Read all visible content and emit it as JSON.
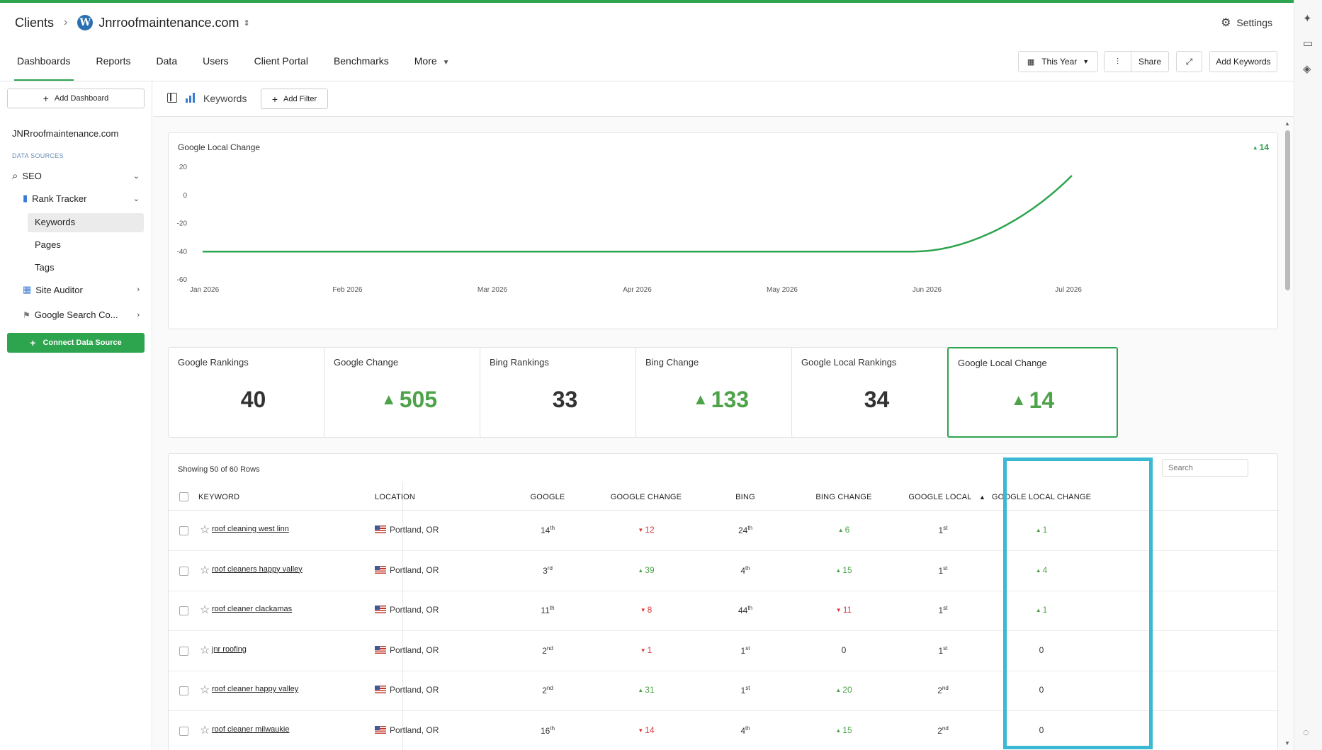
{
  "header": {
    "clients": "Clients",
    "site_name": "Jnrroofmaintenance.com",
    "settings": "Settings"
  },
  "nav": {
    "tabs": [
      "Dashboards",
      "Reports",
      "Data",
      "Users",
      "Client Portal",
      "Benchmarks",
      "More"
    ]
  },
  "toolbar": {
    "date_range": "This Year",
    "share": "Share",
    "add_keywords": "Add Keywords"
  },
  "sidebar": {
    "add_dashboard": "Add Dashboard",
    "site": "JNRroofmaintenance.com",
    "section": "DATA SOURCES",
    "seo": "SEO",
    "rank_tracker": "Rank Tracker",
    "keywords": "Keywords",
    "pages": "Pages",
    "tags": "Tags",
    "site_auditor": "Site Auditor",
    "google_search": "Google Search Co...",
    "connect": "Connect Data Source"
  },
  "filterbar": {
    "title": "Keywords",
    "add_filter": "Add Filter"
  },
  "chart_data": {
    "type": "line",
    "title": "Google Local Change",
    "badge": "14",
    "x": [
      "Jan 2026",
      "Feb 2026",
      "Mar 2026",
      "Apr 2026",
      "May 2026",
      "Jun 2026",
      "Jul 2026"
    ],
    "series": [
      {
        "values": [
          -40,
          -40,
          -40,
          -40,
          -40,
          -40,
          14
        ]
      }
    ],
    "ylim": [
      -60,
      20
    ],
    "yticks": [
      "20",
      "0",
      "-20",
      "-40",
      "-60"
    ],
    "color": "#2da44e",
    "grid": false
  },
  "stats": [
    {
      "title": "Google Rankings",
      "value": "40",
      "trend": "none"
    },
    {
      "title": "Google Change",
      "value": "505",
      "trend": "up"
    },
    {
      "title": "Bing Rankings",
      "value": "33",
      "trend": "none"
    },
    {
      "title": "Bing Change",
      "value": "133",
      "trend": "up"
    },
    {
      "title": "Google Local Rankings",
      "value": "34",
      "trend": "none"
    },
    {
      "title": "Google Local Change",
      "value": "14",
      "trend": "up"
    }
  ],
  "table": {
    "rows_count": "Showing 50 of 60 Rows",
    "search_placeholder": "Search",
    "headers": {
      "keyword": "KEYWORD",
      "location": "LOCATION",
      "google": "GOOGLE",
      "google_change": "GOOGLE CHANGE",
      "bing": "BING",
      "bing_change": "BING CHANGE",
      "google_local": "GOOGLE LOCAL",
      "google_local_change": "GOOGLE LOCAL CHANGE"
    },
    "rows": [
      {
        "keyword": "roof cleaning west linn",
        "location": "Portland, OR",
        "google": "14",
        "google_sup": "th",
        "gchange": "12",
        "gdir": "down",
        "bing": "24",
        "bing_sup": "th",
        "bchange": "6",
        "bdir": "up",
        "local": "1",
        "local_sup": "st",
        "lchange": "1",
        "ldir": "up"
      },
      {
        "keyword": "roof cleaners happy valley",
        "location": "Portland, OR",
        "google": "3",
        "google_sup": "rd",
        "gchange": "39",
        "gdir": "up",
        "bing": "4",
        "bing_sup": "th",
        "bchange": "15",
        "bdir": "up",
        "local": "1",
        "local_sup": "st",
        "lchange": "4",
        "ldir": "up"
      },
      {
        "keyword": "roof cleaner clackamas",
        "location": "Portland, OR",
        "google": "11",
        "google_sup": "th",
        "gchange": "8",
        "gdir": "down",
        "bing": "44",
        "bing_sup": "th",
        "bchange": "11",
        "bdir": "down",
        "local": "1",
        "local_sup": "st",
        "lchange": "1",
        "ldir": "up"
      },
      {
        "keyword": "jnr roofing",
        "location": "Portland, OR",
        "google": "2",
        "google_sup": "nd",
        "gchange": "1",
        "gdir": "down",
        "bing": "1",
        "bing_sup": "st",
        "bchange": "0",
        "bdir": "none",
        "local": "1",
        "local_sup": "st",
        "lchange": "0",
        "ldir": "none"
      },
      {
        "keyword": "roof cleaner happy valley",
        "location": "Portland, OR",
        "google": "2",
        "google_sup": "nd",
        "gchange": "31",
        "gdir": "up",
        "bing": "1",
        "bing_sup": "st",
        "bchange": "20",
        "bdir": "up",
        "local": "2",
        "local_sup": "nd",
        "lchange": "0",
        "ldir": "none"
      },
      {
        "keyword": "roof cleaner milwaukie",
        "location": "Portland, OR",
        "google": "16",
        "google_sup": "th",
        "gchange": "14",
        "gdir": "down",
        "bing": "4",
        "bing_sup": "th",
        "bchange": "15",
        "bdir": "up",
        "local": "2",
        "local_sup": "nd",
        "lchange": "0",
        "ldir": "none"
      }
    ]
  }
}
